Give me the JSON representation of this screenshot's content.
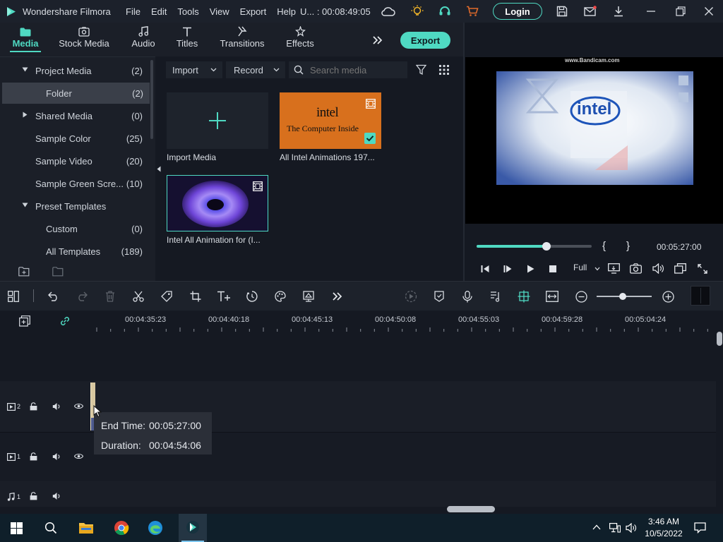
{
  "app": {
    "name": "Wondershare Filmora",
    "menu": [
      "File",
      "Edit",
      "Tools",
      "View",
      "Export",
      "Help"
    ],
    "project_title": "U... : 00:08:49:05",
    "login_label": "Login"
  },
  "tabs": [
    {
      "label": "Media",
      "icon": "folder-icon",
      "active": true
    },
    {
      "label": "Stock Media",
      "icon": "stock-media-icon"
    },
    {
      "label": "Audio",
      "icon": "music-note-icon"
    },
    {
      "label": "Titles",
      "icon": "text-t-icon"
    },
    {
      "label": "Transitions",
      "icon": "transition-icon"
    },
    {
      "label": "Effects",
      "icon": "effects-icon"
    }
  ],
  "export_label": "Export",
  "library": {
    "items": [
      {
        "label": "Project Media",
        "count": "(2)",
        "expanded": true
      },
      {
        "label": "Folder",
        "count": "(2)",
        "selected": true
      },
      {
        "label": "Shared Media",
        "count": "(0)",
        "expanded": false
      },
      {
        "label": "Sample Color",
        "count": "(25)"
      },
      {
        "label": "Sample Video",
        "count": "(20)"
      },
      {
        "label": "Sample Green Scre...",
        "count": "(10)"
      },
      {
        "label": "Preset Templates",
        "count": "",
        "expanded": true
      },
      {
        "label": "Custom",
        "count": "(0)"
      },
      {
        "label": "All Templates",
        "count": "(189)"
      }
    ]
  },
  "media_toolbar": {
    "import_label": "Import",
    "record_label": "Record",
    "search_placeholder": "Search media"
  },
  "media_items": [
    {
      "label": "Import Media"
    },
    {
      "label": "All Intel Animations 197...",
      "thumb_line1": "intel",
      "thumb_line2": "The Computer Inside"
    },
    {
      "label": "Intel All Animation for (I..."
    }
  ],
  "preview": {
    "watermark": "www.Bandicam.com",
    "logo_text": "intel",
    "time": "00:05:27:00",
    "quality": "Full",
    "mark_in": "{",
    "mark_out": "}",
    "progress": 0.61
  },
  "timeline": {
    "ruler": [
      "00:04:35:23",
      "00:04:40:18",
      "00:04:45:13",
      "00:04:50:08",
      "00:04:55:03",
      "00:04:59:28",
      "00:05:04:24"
    ],
    "tracks": [
      {
        "id": "video-2",
        "num": "2"
      },
      {
        "id": "video-1",
        "num": "1"
      },
      {
        "id": "audio-1",
        "num": "1"
      }
    ],
    "tooltip": {
      "end_label": "End Time:",
      "end_value": "00:05:27:00",
      "duration_label": "Duration:",
      "duration_value": "00:04:54:06"
    }
  },
  "taskbar": {
    "time": "3:46 AM",
    "date": "10/5/2022"
  },
  "colors": {
    "accent": "#4fd9c2",
    "orange": "#d8701d"
  }
}
